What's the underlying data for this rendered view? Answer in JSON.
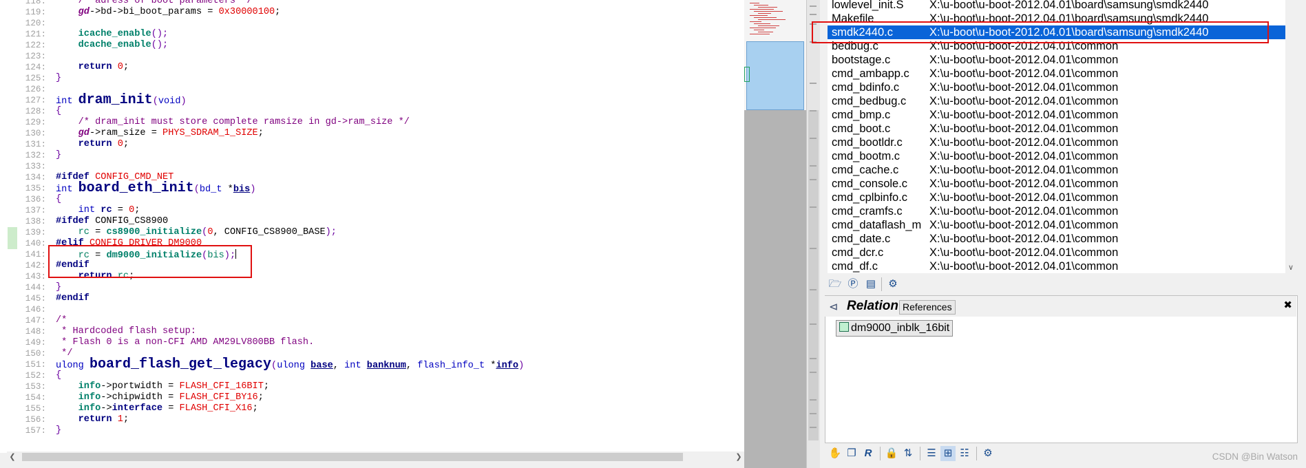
{
  "editor": {
    "lines": [
      {
        "n": "118:",
        "segs": [
          [
            "    /* adress of boot parameters */",
            "cmt"
          ]
        ]
      },
      {
        "n": "119:",
        "segs": [
          [
            "    ",
            "dflt"
          ],
          [
            "gd",
            "gdv"
          ],
          [
            "->bd->bi_boot_params = ",
            "dflt"
          ],
          [
            "0x30000100",
            "num"
          ],
          [
            ";",
            "dflt"
          ]
        ]
      },
      {
        "n": "120:",
        "segs": []
      },
      {
        "n": "121:",
        "segs": [
          [
            "    ",
            "dflt"
          ],
          [
            "icache_enable",
            "fnc"
          ],
          [
            "();",
            "par"
          ]
        ]
      },
      {
        "n": "122:",
        "segs": [
          [
            "    ",
            "dflt"
          ],
          [
            "dcache_enable",
            "fnc"
          ],
          [
            "();",
            "par"
          ]
        ]
      },
      {
        "n": "123:",
        "segs": []
      },
      {
        "n": "124:",
        "segs": [
          [
            "    ",
            "dflt"
          ],
          [
            "return",
            "kwb"
          ],
          [
            " ",
            "dflt"
          ],
          [
            "0",
            "num"
          ],
          [
            ";",
            "dflt"
          ]
        ]
      },
      {
        "n": "125:",
        "segs": [
          [
            "}",
            "par"
          ]
        ]
      },
      {
        "n": "126:",
        "segs": []
      },
      {
        "n": "127:",
        "segs": [
          [
            "int",
            "kw"
          ],
          [
            " ",
            "dflt"
          ],
          [
            "dram_init",
            "fn"
          ],
          [
            "(",
            "par"
          ],
          [
            "void",
            "kw"
          ],
          [
            ")",
            "par"
          ]
        ]
      },
      {
        "n": "128:",
        "segs": [
          [
            "{",
            "par"
          ]
        ]
      },
      {
        "n": "129:",
        "segs": [
          [
            "    /* dram_init must store complete ramsize in gd->ram_size */",
            "cmt"
          ]
        ]
      },
      {
        "n": "130:",
        "segs": [
          [
            "    ",
            "dflt"
          ],
          [
            "gd",
            "gdv"
          ],
          [
            "->ram_size = ",
            "dflt"
          ],
          [
            "PHYS_SDRAM_1_SIZE",
            "mac"
          ],
          [
            ";",
            "dflt"
          ]
        ]
      },
      {
        "n": "131:",
        "segs": [
          [
            "    ",
            "dflt"
          ],
          [
            "return",
            "kwb"
          ],
          [
            " ",
            "dflt"
          ],
          [
            "0",
            "num"
          ],
          [
            ";",
            "dflt"
          ]
        ]
      },
      {
        "n": "132:",
        "segs": [
          [
            "}",
            "par"
          ]
        ]
      },
      {
        "n": "133:",
        "segs": []
      },
      {
        "n": "134:",
        "segs": [
          [
            "#ifdef",
            "kwb"
          ],
          [
            " ",
            "dflt"
          ],
          [
            "CONFIG_CMD_NET",
            "mac"
          ]
        ]
      },
      {
        "n": "135:",
        "segs": [
          [
            "int",
            "kw"
          ],
          [
            " ",
            "dflt"
          ],
          [
            "board_eth_init",
            "fn"
          ],
          [
            "(",
            "par"
          ],
          [
            "bd_t",
            "kw"
          ],
          [
            " *",
            "dflt"
          ],
          [
            "bis",
            "prm"
          ],
          [
            ")",
            "par"
          ]
        ]
      },
      {
        "n": "136:",
        "segs": [
          [
            "{",
            "par"
          ]
        ]
      },
      {
        "n": "137:",
        "segs": [
          [
            "    ",
            "dflt"
          ],
          [
            "int",
            "kw"
          ],
          [
            " ",
            "dflt"
          ],
          [
            "rc",
            "kwb"
          ],
          [
            " = ",
            "dflt"
          ],
          [
            "0",
            "num"
          ],
          [
            ";",
            "dflt"
          ]
        ]
      },
      {
        "n": "138:",
        "segs": [
          [
            "#ifdef",
            "kwb"
          ],
          [
            " CONFIG_CS8900",
            "dflt"
          ]
        ]
      },
      {
        "n": "139:",
        "segs": [
          [
            "    ",
            "dflt"
          ],
          [
            "rc",
            "var"
          ],
          [
            " = ",
            "dflt"
          ],
          [
            "cs8900_initialize",
            "fnc"
          ],
          [
            "(",
            "par"
          ],
          [
            "0",
            "num"
          ],
          [
            ", CONFIG_CS8900_BASE",
            "dflt"
          ],
          [
            ");",
            "par"
          ]
        ]
      },
      {
        "n": "140:",
        "segs": [
          [
            "#elif",
            "kwb"
          ],
          [
            " ",
            "dflt"
          ],
          [
            "CONFIG_DRIVER_DM9000",
            "mac"
          ]
        ]
      },
      {
        "n": "141:",
        "segs": [
          [
            "    ",
            "dflt"
          ],
          [
            "rc",
            "var"
          ],
          [
            " = ",
            "dflt"
          ],
          [
            "dm9000_initialize",
            "fnc"
          ],
          [
            "(",
            "par"
          ],
          [
            "bis",
            "var"
          ],
          [
            ");",
            "par"
          ]
        ]
      },
      {
        "n": "142:",
        "segs": [
          [
            "#endif",
            "kwb"
          ]
        ]
      },
      {
        "n": "143:",
        "segs": [
          [
            "    ",
            "dflt"
          ],
          [
            "return",
            "kwb"
          ],
          [
            " ",
            "dflt"
          ],
          [
            "rc",
            "var"
          ],
          [
            ";",
            "dflt"
          ]
        ]
      },
      {
        "n": "144:",
        "segs": [
          [
            "}",
            "par"
          ]
        ]
      },
      {
        "n": "145:",
        "segs": [
          [
            "#endif",
            "kwb"
          ]
        ]
      },
      {
        "n": "146:",
        "segs": []
      },
      {
        "n": "147:",
        "segs": [
          [
            "/*",
            "cmt"
          ]
        ]
      },
      {
        "n": "148:",
        "segs": [
          [
            " * Hardcoded flash setup:",
            "cmt"
          ]
        ]
      },
      {
        "n": "149:",
        "segs": [
          [
            " * Flash 0 is a non-CFI AMD AM29LV800BB flash.",
            "cmt"
          ]
        ]
      },
      {
        "n": "150:",
        "segs": [
          [
            " */",
            "cmt"
          ]
        ]
      },
      {
        "n": "151:",
        "segs": [
          [
            "ulong",
            "kw"
          ],
          [
            " ",
            "dflt"
          ],
          [
            "board_flash_get_legacy",
            "fn"
          ],
          [
            "(",
            "par"
          ],
          [
            "ulong",
            "kw"
          ],
          [
            " ",
            "dflt"
          ],
          [
            "base",
            "prm"
          ],
          [
            ", ",
            "dflt"
          ],
          [
            "int",
            "kw"
          ],
          [
            " ",
            "dflt"
          ],
          [
            "banknum",
            "prm"
          ],
          [
            ", ",
            "dflt"
          ],
          [
            "flash_info_t",
            "kw"
          ],
          [
            " *",
            "dflt"
          ],
          [
            "info",
            "prm"
          ],
          [
            ")",
            "par"
          ]
        ]
      },
      {
        "n": "152:",
        "segs": [
          [
            "{",
            "par"
          ]
        ]
      },
      {
        "n": "153:",
        "segs": [
          [
            "    ",
            "dflt"
          ],
          [
            "info",
            "fnc"
          ],
          [
            "->portwidth = ",
            "dflt"
          ],
          [
            "FLASH_CFI_16BIT",
            "mac"
          ],
          [
            ";",
            "dflt"
          ]
        ]
      },
      {
        "n": "154:",
        "segs": [
          [
            "    ",
            "dflt"
          ],
          [
            "info",
            "fnc"
          ],
          [
            "->chipwidth = ",
            "dflt"
          ],
          [
            "FLASH_CFI_BY16",
            "mac"
          ],
          [
            ";",
            "dflt"
          ]
        ]
      },
      {
        "n": "155:",
        "segs": [
          [
            "    ",
            "dflt"
          ],
          [
            "info",
            "fnc"
          ],
          [
            "->",
            "dflt"
          ],
          [
            "interface",
            "kwb"
          ],
          [
            " = ",
            "dflt"
          ],
          [
            "FLASH_CFI_X16",
            "mac"
          ],
          [
            ";",
            "dflt"
          ]
        ]
      },
      {
        "n": "156:",
        "segs": [
          [
            "    ",
            "dflt"
          ],
          [
            "return",
            "kwb"
          ],
          [
            " ",
            "dflt"
          ],
          [
            "1",
            "num"
          ],
          [
            ";",
            "dflt"
          ]
        ]
      },
      {
        "n": "157:",
        "segs": [
          [
            "}",
            "par"
          ]
        ]
      }
    ]
  },
  "files": [
    {
      "name": "lowlevel_init.S",
      "path": "X:\\u-boot\\u-boot-2012.04.01\\board\\samsung\\smdk2440"
    },
    {
      "name": "Makefile",
      "path": "X:\\u-boot\\u-boot-2012.04.01\\board\\samsung\\smdk2440"
    },
    {
      "name": "smdk2440.c",
      "path": "X:\\u-boot\\u-boot-2012.04.01\\board\\samsung\\smdk2440",
      "selected": true
    },
    {
      "name": "bedbug.c",
      "path": "X:\\u-boot\\u-boot-2012.04.01\\common"
    },
    {
      "name": "bootstage.c",
      "path": "X:\\u-boot\\u-boot-2012.04.01\\common"
    },
    {
      "name": "cmd_ambapp.c",
      "path": "X:\\u-boot\\u-boot-2012.04.01\\common"
    },
    {
      "name": "cmd_bdinfo.c",
      "path": "X:\\u-boot\\u-boot-2012.04.01\\common"
    },
    {
      "name": "cmd_bedbug.c",
      "path": "X:\\u-boot\\u-boot-2012.04.01\\common"
    },
    {
      "name": "cmd_bmp.c",
      "path": "X:\\u-boot\\u-boot-2012.04.01\\common"
    },
    {
      "name": "cmd_boot.c",
      "path": "X:\\u-boot\\u-boot-2012.04.01\\common"
    },
    {
      "name": "cmd_bootldr.c",
      "path": "X:\\u-boot\\u-boot-2012.04.01\\common"
    },
    {
      "name": "cmd_bootm.c",
      "path": "X:\\u-boot\\u-boot-2012.04.01\\common"
    },
    {
      "name": "cmd_cache.c",
      "path": "X:\\u-boot\\u-boot-2012.04.01\\common"
    },
    {
      "name": "cmd_console.c",
      "path": "X:\\u-boot\\u-boot-2012.04.01\\common"
    },
    {
      "name": "cmd_cplbinfo.c",
      "path": "X:\\u-boot\\u-boot-2012.04.01\\common"
    },
    {
      "name": "cmd_cramfs.c",
      "path": "X:\\u-boot\\u-boot-2012.04.01\\common"
    },
    {
      "name": "cmd_dataflash_mr",
      "path": "X:\\u-boot\\u-boot-2012.04.01\\common"
    },
    {
      "name": "cmd_date.c",
      "path": "X:\\u-boot\\u-boot-2012.04.01\\common"
    },
    {
      "name": "cmd_dcr.c",
      "path": "X:\\u-boot\\u-boot-2012.04.01\\common"
    },
    {
      "name": "cmd_df.c",
      "path": "X:\\u-boot\\u-boot-2012.04.01\\common"
    }
  ],
  "relation": {
    "title": "Relation",
    "tab": "References",
    "item": "dm9000_inblk_16bit"
  },
  "watermark": "CSDN @Bin Watson",
  "colors": {
    "highlight_box": "#e01010",
    "selection": "#0a64d8"
  }
}
